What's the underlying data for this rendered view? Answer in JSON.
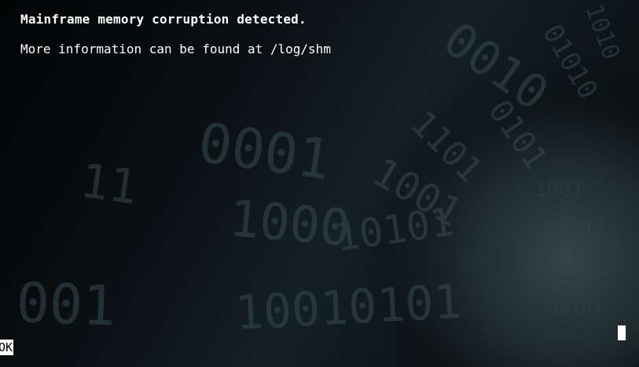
{
  "message": {
    "title": "Mainframe memory corruption detected.",
    "info": "More information can be found at /log/shm"
  },
  "dialog": {
    "ok_label": "OK"
  },
  "background": {
    "description_icon": "binary-tunnel-image",
    "accent": "#2c3a3f",
    "base": "#000000",
    "text_color": "#ffffff"
  },
  "cursor": {
    "icon": "text-cursor-block"
  }
}
